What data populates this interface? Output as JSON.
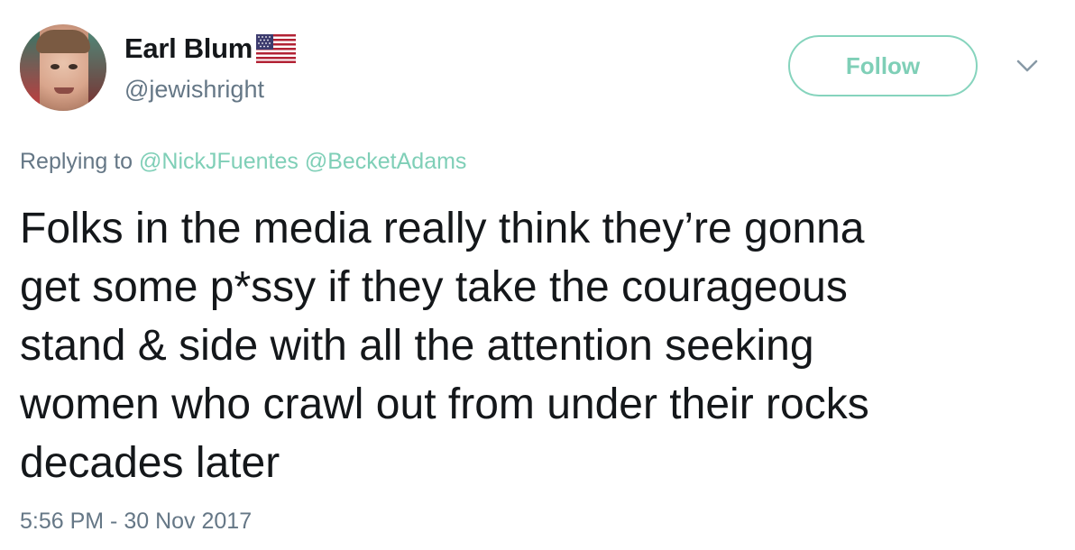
{
  "user": {
    "display_name": "Earl Blum",
    "flag_icon": "us-flag-icon",
    "handle": "@jewishright",
    "avatar_icon": "profile-photo"
  },
  "actions": {
    "follow_label": "Follow",
    "menu_icon": "chevron-down-icon"
  },
  "reply": {
    "prefix": "Replying to",
    "mentions": [
      "@NickJFuentes",
      "@BecketAdams"
    ]
  },
  "tweet": {
    "text_lines": [
      "Folks in the media really think they’re gonna",
      "get some p*ssy if they take the courageous",
      "stand & side with all the attention seeking",
      "women who crawl out from under their rocks",
      "decades later"
    ],
    "timestamp": "5:56 PM - 30 Nov 2017"
  },
  "colors": {
    "accent": "#7fcfb7",
    "muted": "#657786",
    "text": "#14171a"
  }
}
